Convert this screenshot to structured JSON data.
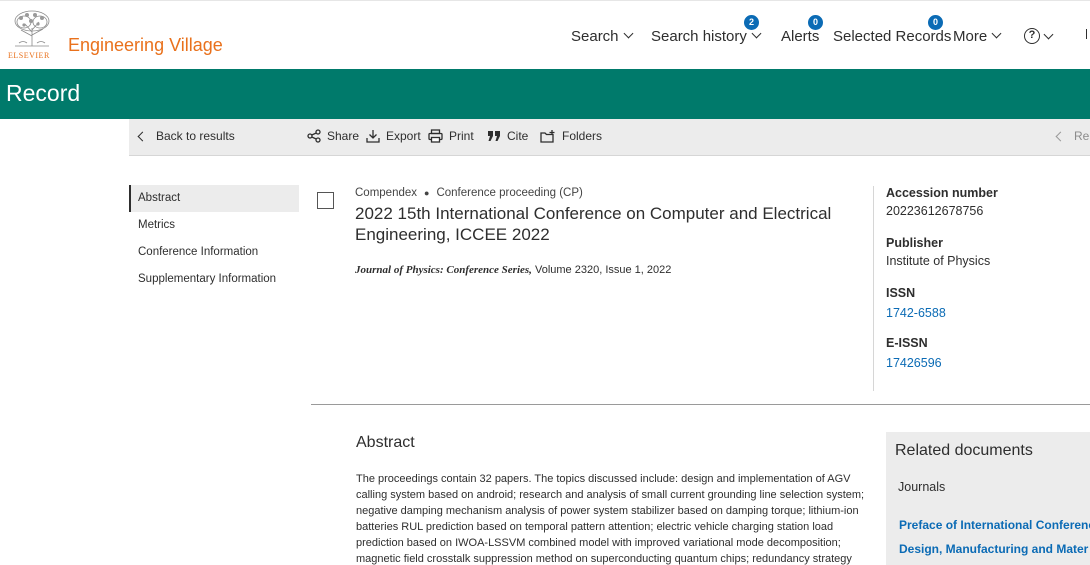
{
  "brand": {
    "publisher": "ELSEVIER",
    "product": "Engineering Village",
    "color": "#e9711c"
  },
  "header_nav": {
    "search": "Search",
    "search_history": "Search history",
    "search_history_badge": "2",
    "alerts": "Alerts",
    "alerts_badge": "0",
    "selected_records": "Selected Records",
    "selected_records_badge": "0",
    "more": "More",
    "help_glyph": "?"
  },
  "page": {
    "title": "Record",
    "band_color": "#007a6b"
  },
  "toolbar": {
    "back": "Back to results",
    "share": "Share",
    "export": "Export",
    "print": "Print",
    "cite": "Cite",
    "folders": "Folders",
    "prev_partial": "Re"
  },
  "left_nav": {
    "items": [
      {
        "label": "Abstract"
      },
      {
        "label": "Metrics"
      },
      {
        "label": "Conference Information"
      },
      {
        "label": "Supplementary Information"
      }
    ]
  },
  "record": {
    "database": "Compendex",
    "doc_type": "Conference proceeding (CP)",
    "title": "2022 15th International Conference on Computer and Electrical Engineering, ICCEE 2022",
    "journal": "Journal of Physics: Conference Series,",
    "volume_issue": "Volume 2320, Issue 1, 2022"
  },
  "metadata": {
    "accession_label": "Accession number",
    "accession_value": "20223612678756",
    "publisher_label": "Publisher",
    "publisher_value": "Institute of Physics",
    "issn_label": "ISSN",
    "issn_value": "1742-6588",
    "eissn_label": "E-ISSN",
    "eissn_value": "17426596"
  },
  "abstract": {
    "heading": "Abstract",
    "lines": [
      "The proceedings contain 32 papers. The topics discussed include: design and implementation of AGV",
      "calling system based on android; research and analysis of small current grounding line selection system;",
      "negative damping mechanism analysis of power system stabilizer based on damping torque; lithium-ion",
      "batteries RUL prediction based on temporal pattern attention; electric vehicle charging station load",
      "prediction based on IWOA-LSSVM combined model with improved variational mode decomposition;",
      "magnetic field crosstalk suppression method on superconducting quantum chips; redundancy strategy"
    ]
  },
  "related": {
    "heading": "Related documents",
    "section": "Journals",
    "links": [
      "Preface of International Conference",
      "Design, Manufacturing and Mater"
    ]
  }
}
